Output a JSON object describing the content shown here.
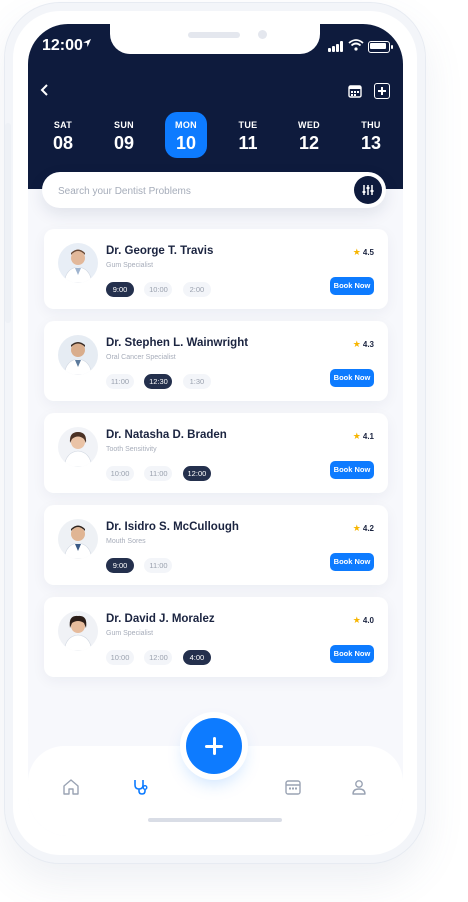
{
  "status": {
    "time": "12:00",
    "location_icon": "location-arrow-icon"
  },
  "header": {
    "days": [
      {
        "name": "SAT",
        "date": "08"
      },
      {
        "name": "SUN",
        "date": "09"
      },
      {
        "name": "MON",
        "date": "10",
        "active": true
      },
      {
        "name": "TUE",
        "date": "11"
      },
      {
        "name": "WED",
        "date": "12"
      },
      {
        "name": "THU",
        "date": "13"
      }
    ]
  },
  "search": {
    "placeholder": "Search your Dentist Problems"
  },
  "doctors": [
    {
      "name": "Dr. George T. Travis",
      "specialty": "Gum Specialist",
      "rating": "4.5",
      "slots": [
        "9:00",
        "10:00",
        "2:00"
      ],
      "selected": "9:00",
      "book": "Book Now"
    },
    {
      "name": "Dr. Stephen L. Wainwright",
      "specialty": "Oral Cancer Specialist",
      "rating": "4.3",
      "slots": [
        "11:00",
        "12:30",
        "1:30"
      ],
      "selected": "12:30",
      "book": "Book Now"
    },
    {
      "name": "Dr. Natasha D. Braden",
      "specialty": "Tooth Sensitivity",
      "rating": "4.1",
      "slots": [
        "10:00",
        "11:00",
        "12:00"
      ],
      "selected": "12:00",
      "book": "Book Now"
    },
    {
      "name": "Dr. Isidro S. McCullough",
      "specialty": "Mouth Sores",
      "rating": "4.2",
      "slots": [
        "9:00",
        "11:00"
      ],
      "selected": "9:00",
      "book": "Book Now"
    },
    {
      "name": "Dr. David J. Moralez",
      "specialty": "Gum Specialist",
      "rating": "4.0",
      "slots": [
        "10:00",
        "12:00",
        "4:00"
      ],
      "selected": "4:00",
      "book": "Book Now"
    }
  ],
  "nav": {
    "items": [
      "home-icon",
      "stethoscope-icon",
      "calendar-icon",
      "profile-icon"
    ],
    "active": "stethoscope-icon"
  },
  "colors": {
    "header": "#0e1b3d",
    "accent": "#0d7bff",
    "star": "#f7b500",
    "selected_slot": "#24304d"
  }
}
